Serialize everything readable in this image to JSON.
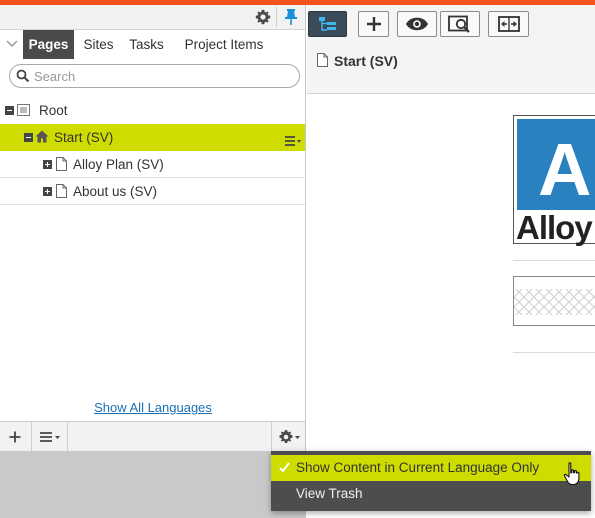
{
  "colors": {
    "accent": "#f4511e",
    "selection": "#cedc00",
    "link": "#1b6fb5",
    "active_tab": "#4a4a4a",
    "toolbar_active": "#3b4b59",
    "menu_bg": "#4d4d4d",
    "logo_blue": "#2a81bf"
  },
  "nav": {
    "top_icons": [
      "gear-icon",
      "pin-icon"
    ],
    "tabs": [
      {
        "label": "Pages",
        "active": true
      },
      {
        "label": "Sites",
        "active": false
      },
      {
        "label": "Tasks",
        "active": false
      },
      {
        "label": "Project Items",
        "active": false
      }
    ],
    "search_placeholder": "Search",
    "tree": [
      {
        "label": "Root",
        "icon": "root-list-icon",
        "expanded": true,
        "selected": false
      },
      {
        "label": "Start (SV)",
        "icon": "home-icon",
        "expanded": true,
        "selected": true
      },
      {
        "label": "Alloy Plan (SV)",
        "icon": "page-icon",
        "expanded": false,
        "selected": false
      },
      {
        "label": "About us (SV)",
        "icon": "page-icon",
        "expanded": false,
        "selected": false
      }
    ],
    "show_all_languages": "Show All Languages",
    "bottom_icons": [
      "add-icon",
      "list-menu-icon",
      "gear-icon"
    ]
  },
  "toolbar": {
    "buttons": [
      "page-tree-icon",
      "add-icon",
      "preview-eye-icon",
      "compare-preview-icon",
      "side-by-side-icon"
    ]
  },
  "content": {
    "page_title": "Start (SV)",
    "logo_letter": "A",
    "logo_word": "Alloy"
  },
  "context_menu": {
    "items": [
      {
        "label": "Show Content in Current Language Only",
        "checked": true
      },
      {
        "label": "View Trash",
        "checked": false
      }
    ]
  }
}
